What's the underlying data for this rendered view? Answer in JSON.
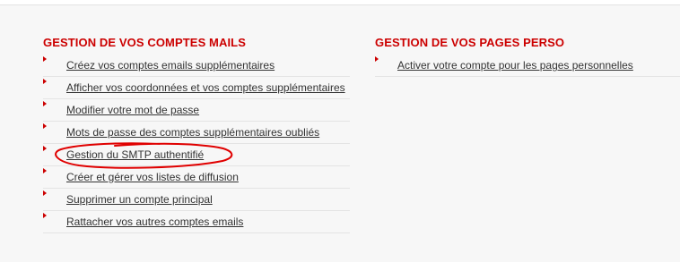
{
  "mail_section": {
    "title": "GESTION DE VOS COMPTES MAILS",
    "links": [
      {
        "label": "Créez vos comptes emails supplémentaires"
      },
      {
        "label": "Afficher vos coordonnées et vos comptes supplémentaires"
      },
      {
        "label": "Modifier votre mot de passe"
      },
      {
        "label": "Mots de passe des comptes supplémentaires oubliés"
      },
      {
        "label": "Gestion du SMTP authentifié"
      },
      {
        "label": "Créer et gérer vos listes de diffusion"
      },
      {
        "label": "Supprimer un compte principal"
      },
      {
        "label": "Rattacher vos autres comptes emails"
      }
    ]
  },
  "pages_section": {
    "title": "GESTION DE VOS PAGES PERSO",
    "links": [
      {
        "label": "Activer votre compte pour les pages personnelles"
      }
    ]
  },
  "colors": {
    "accent": "#cc0000",
    "link": "#333333",
    "annotation": "#e00000"
  }
}
